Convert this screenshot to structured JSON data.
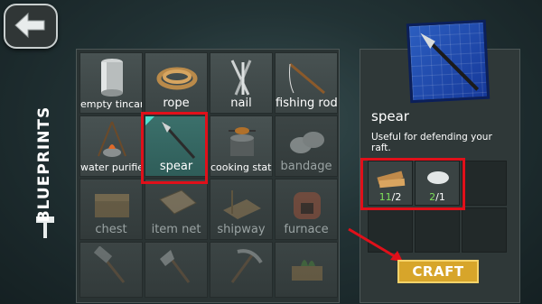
{
  "header": {
    "back_label": "back"
  },
  "sidebar": {
    "title": "BLUEPRINTS"
  },
  "blueprints": [
    {
      "label": "empty tincan",
      "icon": "tincan-icon",
      "locked": false
    },
    {
      "label": "rope",
      "icon": "rope-icon",
      "locked": false
    },
    {
      "label": "nail",
      "icon": "nail-icon",
      "locked": false
    },
    {
      "label": "fishing rod",
      "icon": "fishing-rod-icon",
      "locked": false
    },
    {
      "label": "water purifier",
      "icon": "water-purifier-icon",
      "locked": false
    },
    {
      "label": "spear",
      "icon": "spear-icon",
      "locked": false,
      "selected": true
    },
    {
      "label": "cooking station",
      "icon": "cooking-station-icon",
      "locked": false
    },
    {
      "label": "bandage",
      "icon": "bandage-icon",
      "locked": true
    },
    {
      "label": "chest",
      "icon": "chest-icon",
      "locked": true
    },
    {
      "label": "item net",
      "icon": "item-net-icon",
      "locked": true
    },
    {
      "label": "shipway",
      "icon": "shipway-icon",
      "locked": true
    },
    {
      "label": "furnace",
      "icon": "furnace-icon",
      "locked": true
    },
    {
      "label": "",
      "icon": "hammer-icon",
      "locked": true
    },
    {
      "label": "",
      "icon": "axe-icon",
      "locked": true
    },
    {
      "label": "",
      "icon": "pickaxe-icon",
      "locked": true
    },
    {
      "label": "",
      "icon": "planter-icon",
      "locked": true
    }
  ],
  "detail": {
    "title": "spear",
    "description": "Useful for defending your raft.",
    "requirements": [
      {
        "icon": "plank-icon",
        "have": "11",
        "need": "/2"
      },
      {
        "icon": "cloth-icon",
        "have": "2",
        "need": "/1"
      }
    ],
    "craft_label": "CRAFT"
  },
  "colors": {
    "accent_red": "#e0101a",
    "craft_yellow": "#d7a52a",
    "have_green": "#7ee05a"
  }
}
